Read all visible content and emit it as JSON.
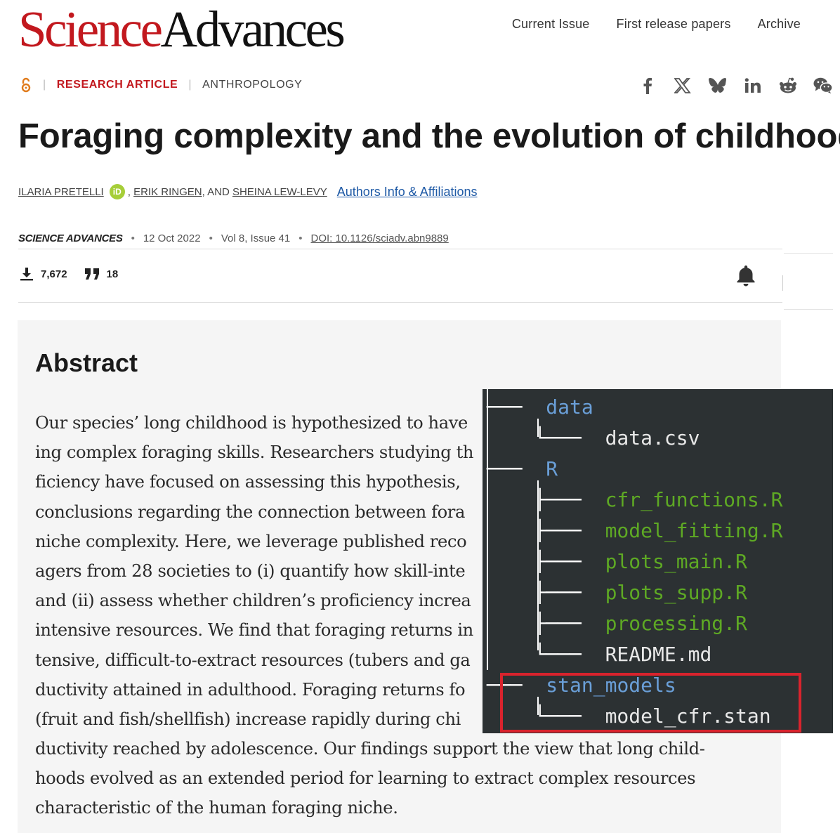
{
  "header": {
    "logo_part1": "Science",
    "logo_part2": "Advances",
    "nav": [
      "Current Issue",
      "First release papers",
      "Archive"
    ]
  },
  "meta": {
    "article_type": "RESEARCH ARTICLE",
    "subject": "ANTHROPOLOGY"
  },
  "share_icons": [
    "facebook-icon",
    "x-icon",
    "bluesky-icon",
    "linkedin-icon",
    "reddit-icon",
    "wechat-icon"
  ],
  "article": {
    "title": "Foraging complexity and the evolution of childhood",
    "authors": [
      "ILARIA PRETELLI",
      "ERIK RINGEN",
      "SHEINA LEW-LEVY"
    ],
    "author_sep1": ",",
    "author_sep2": ", AND",
    "orcid_label": "iD",
    "affiliations_link": "Authors Info & Affiliations"
  },
  "citation": {
    "journal": "SCIENCE ADVANCES",
    "date": "12 Oct 2022",
    "volume": "Vol 8, Issue 41",
    "doi": "DOI: 10.1126/sciadv.abn9889"
  },
  "metrics": {
    "downloads": "7,672",
    "citations": "18"
  },
  "abstract": {
    "heading": "Abstract",
    "lines": [
      "Our species’ long childhood is hypothesized to have",
      "ing complex foraging skills. Researchers studying th",
      "ficiency have focused on assessing this hypothesis,",
      "conclusions regarding the connection between fora",
      "niche complexity. Here, we leverage published reco",
      "agers from 28 societies to (i) quantify how skill-inte",
      "and (ii) assess whether children’s proficiency increa",
      "intensive resources. We find that foraging returns in",
      "tensive, difficult-to-extract resources (tubers and ga",
      "ductivity attained in adulthood. Foraging returns fo",
      "(fruit and fish/shellfish) increase rapidly during chi",
      "ductivity reached by adolescence. Our findings support the view that long child-",
      "hoods evolved as an extended period for learning to extract complex resources",
      "characteristic of the human foraging niche."
    ]
  },
  "file_tree": {
    "entries": [
      {
        "prefix": "───  ",
        "name": "data",
        "kind": "dir"
      },
      {
        "prefix": "    └───  ",
        "name": "data.csv",
        "kind": "file"
      },
      {
        "prefix": "───  ",
        "name": "R",
        "kind": "dir"
      },
      {
        "prefix": "    ├───  ",
        "name": "cfr_functions.R",
        "kind": "r"
      },
      {
        "prefix": "    ├───  ",
        "name": "model_fitting.R",
        "kind": "r"
      },
      {
        "prefix": "    ├───  ",
        "name": "plots_main.R",
        "kind": "r"
      },
      {
        "prefix": "    ├───  ",
        "name": "plots_supp.R",
        "kind": "r"
      },
      {
        "prefix": "    ├───  ",
        "name": "processing.R",
        "kind": "r"
      },
      {
        "prefix": "    └───  ",
        "name": "README.md",
        "kind": "file"
      },
      {
        "prefix": "───  ",
        "name": "stan_models",
        "kind": "dir"
      },
      {
        "prefix": "    └───  ",
        "name": "model_cfr.stan",
        "kind": "file"
      }
    ],
    "colors": {
      "dir": "#6a9fd8",
      "r": "#5ea924",
      "file": "#e8e8e8",
      "highlight": "#d9232d"
    }
  }
}
